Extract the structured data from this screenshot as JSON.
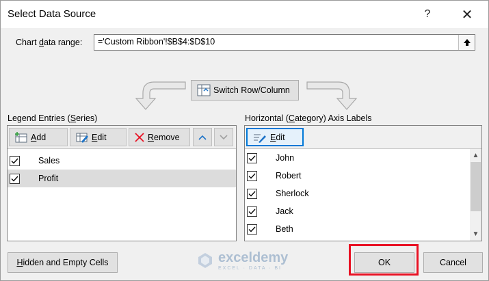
{
  "window": {
    "title": "Select Data Source",
    "help_label": "?",
    "close_label": "✕"
  },
  "range": {
    "label": "Chart data range:",
    "value": "='Custom Ribbon'!$B$4:$D$10"
  },
  "switch_button": "Switch Row/Column",
  "legend": {
    "title": "Legend Entries (Series)",
    "add_label": "Add",
    "edit_label": "Edit",
    "remove_label": "Remove",
    "items": [
      "Sales",
      "Profit"
    ]
  },
  "axis": {
    "title": "Horizontal (Category) Axis Labels",
    "edit_label": "Edit",
    "items": [
      "John",
      "Robert",
      "Sherlock",
      "Jack",
      "Beth"
    ]
  },
  "buttons": {
    "hidden_empty": "Hidden and Empty Cells",
    "ok": "OK",
    "cancel": "Cancel"
  },
  "watermark": {
    "name": "exceldemy",
    "tagline": "EXCEL · DATA · BI"
  },
  "colors": {
    "highlight_border": "#e81123",
    "selected_row": "#dcdcdc",
    "focus_blue": "#0078d7",
    "remove_red": "#e81123"
  }
}
